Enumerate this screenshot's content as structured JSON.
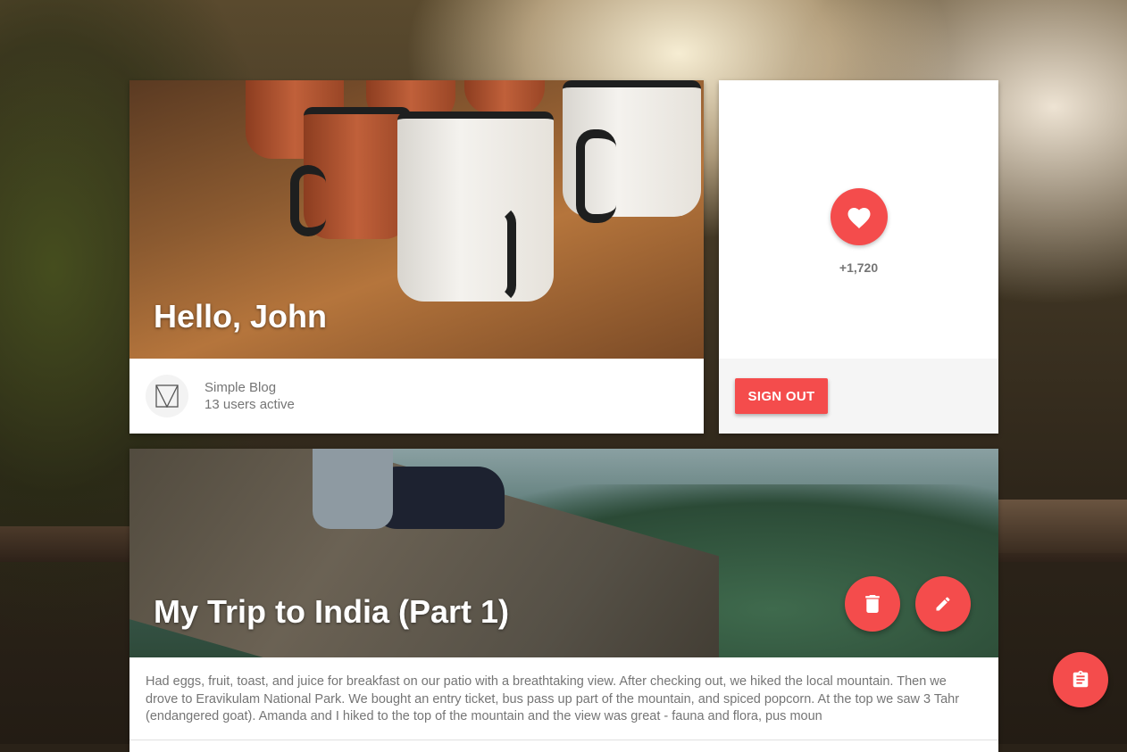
{
  "hello_card": {
    "title": "Hello, John",
    "blog_name": "Simple Blog",
    "users_active": "13 users active"
  },
  "like_card": {
    "count": "+1,720",
    "signout_label": "SIGN OUT"
  },
  "trip_card": {
    "title": "My Trip to India (Part 1)",
    "excerpt": "Had eggs, fruit, toast, and juice for breakfast on our patio with a breathtaking view. After checking out, we hiked the local mountain. Then we drove to Eravikulam National Park. We bought an entry ticket, bus pass up part of the mountain, and spiced popcorn. At the top we saw 3 Tahr (endangered goat). Amanda and I hiked to the top of the mountain and the view was great - fauna and flora, pus moun"
  },
  "icons": {
    "like": "heart-icon",
    "delete": "trash-icon",
    "edit": "pencil-icon",
    "fab": "clipboard-icon",
    "logo": "m-logo-icon"
  },
  "colors": {
    "accent": "#f44c4c",
    "text_secondary": "#757575",
    "card_footer": "#f5f5f5"
  }
}
